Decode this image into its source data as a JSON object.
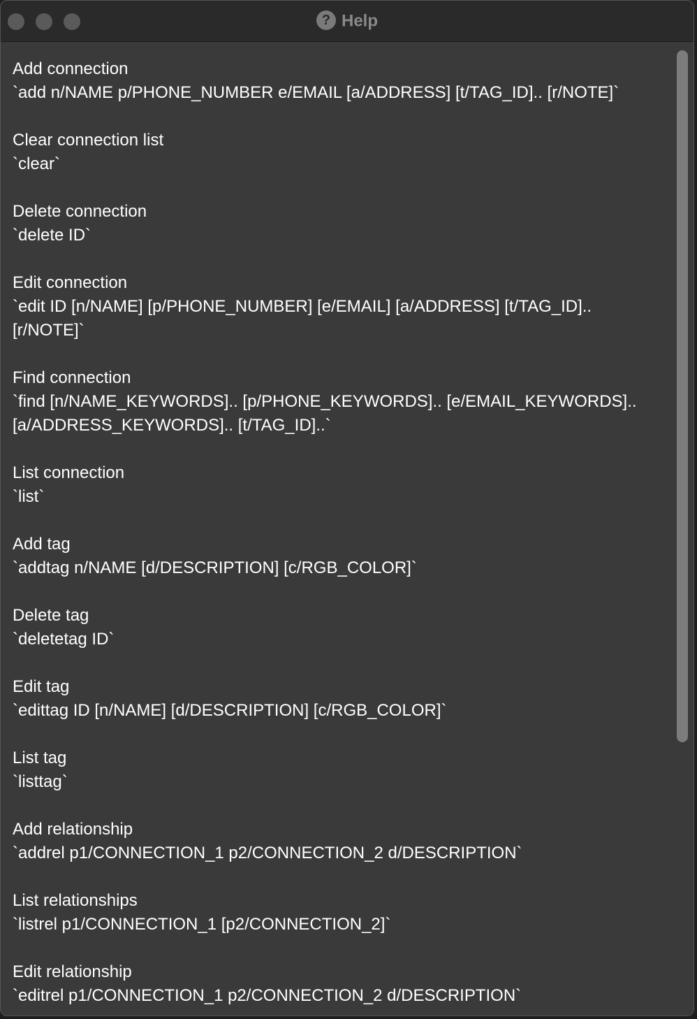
{
  "window": {
    "title": "Help",
    "title_icon": "?"
  },
  "help": {
    "entries": [
      {
        "title": "Add connection",
        "command": "`add n/NAME p/PHONE_NUMBER e/EMAIL [a/ADDRESS] [t/TAG_ID].. [r/NOTE]`"
      },
      {
        "title": "Clear connection list",
        "command": "`clear`"
      },
      {
        "title": "Delete connection",
        "command": "`delete ID`"
      },
      {
        "title": "Edit connection",
        "command": "`edit ID [n/NAME] [p/PHONE_NUMBER] [e/EMAIL] [a/ADDRESS] [t/TAG_ID].. [r/NOTE]`"
      },
      {
        "title": "Find connection",
        "command": "`find [n/NAME_KEYWORDS].. [p/PHONE_KEYWORDS].. [e/EMAIL_KEYWORDS].. [a/ADDRESS_KEYWORDS].. [t/TAG_ID]..`"
      },
      {
        "title": "List connection",
        "command": "`list`"
      },
      {
        "title": "Add tag",
        "command": "`addtag n/NAME [d/DESCRIPTION] [c/RGB_COLOR]`"
      },
      {
        "title": "Delete tag",
        "command": "`deletetag ID`"
      },
      {
        "title": "Edit tag",
        "command": "`edittag ID [n/NAME] [d/DESCRIPTION] [c/RGB_COLOR]`"
      },
      {
        "title": "List tag",
        "command": "`listtag`"
      },
      {
        "title": "Add relationship",
        "command": "`addrel p1/CONNECTION_1 p2/CONNECTION_2 d/DESCRIPTION`"
      },
      {
        "title": "List relationships",
        "command": "`listrel p1/CONNECTION_1 [p2/CONNECTION_2]`"
      },
      {
        "title": "Edit relationship",
        "command": "`editrel p1/CONNECTION_1 p2/CONNECTION_2 d/DESCRIPTION`"
      }
    ]
  },
  "scrollbar": {
    "scroll_position": 0.0
  }
}
